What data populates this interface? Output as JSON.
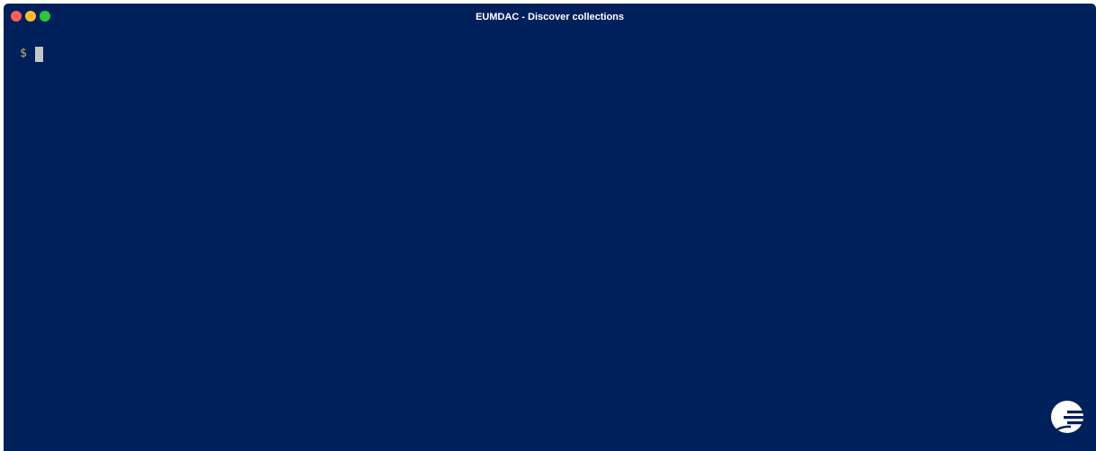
{
  "window": {
    "title": "EUMDAC - Discover collections",
    "background_color": "#00205b"
  },
  "traffic_lights": {
    "close_color": "#ff5f56",
    "minimize_color": "#ffbd2e",
    "maximize_color": "#27c93f"
  },
  "terminal": {
    "prompt": "$",
    "input": "",
    "prompt_color": "#c8b560",
    "cursor_color": "#c5c5c5"
  },
  "logo": {
    "icon": "eumetsat-logo-icon"
  }
}
